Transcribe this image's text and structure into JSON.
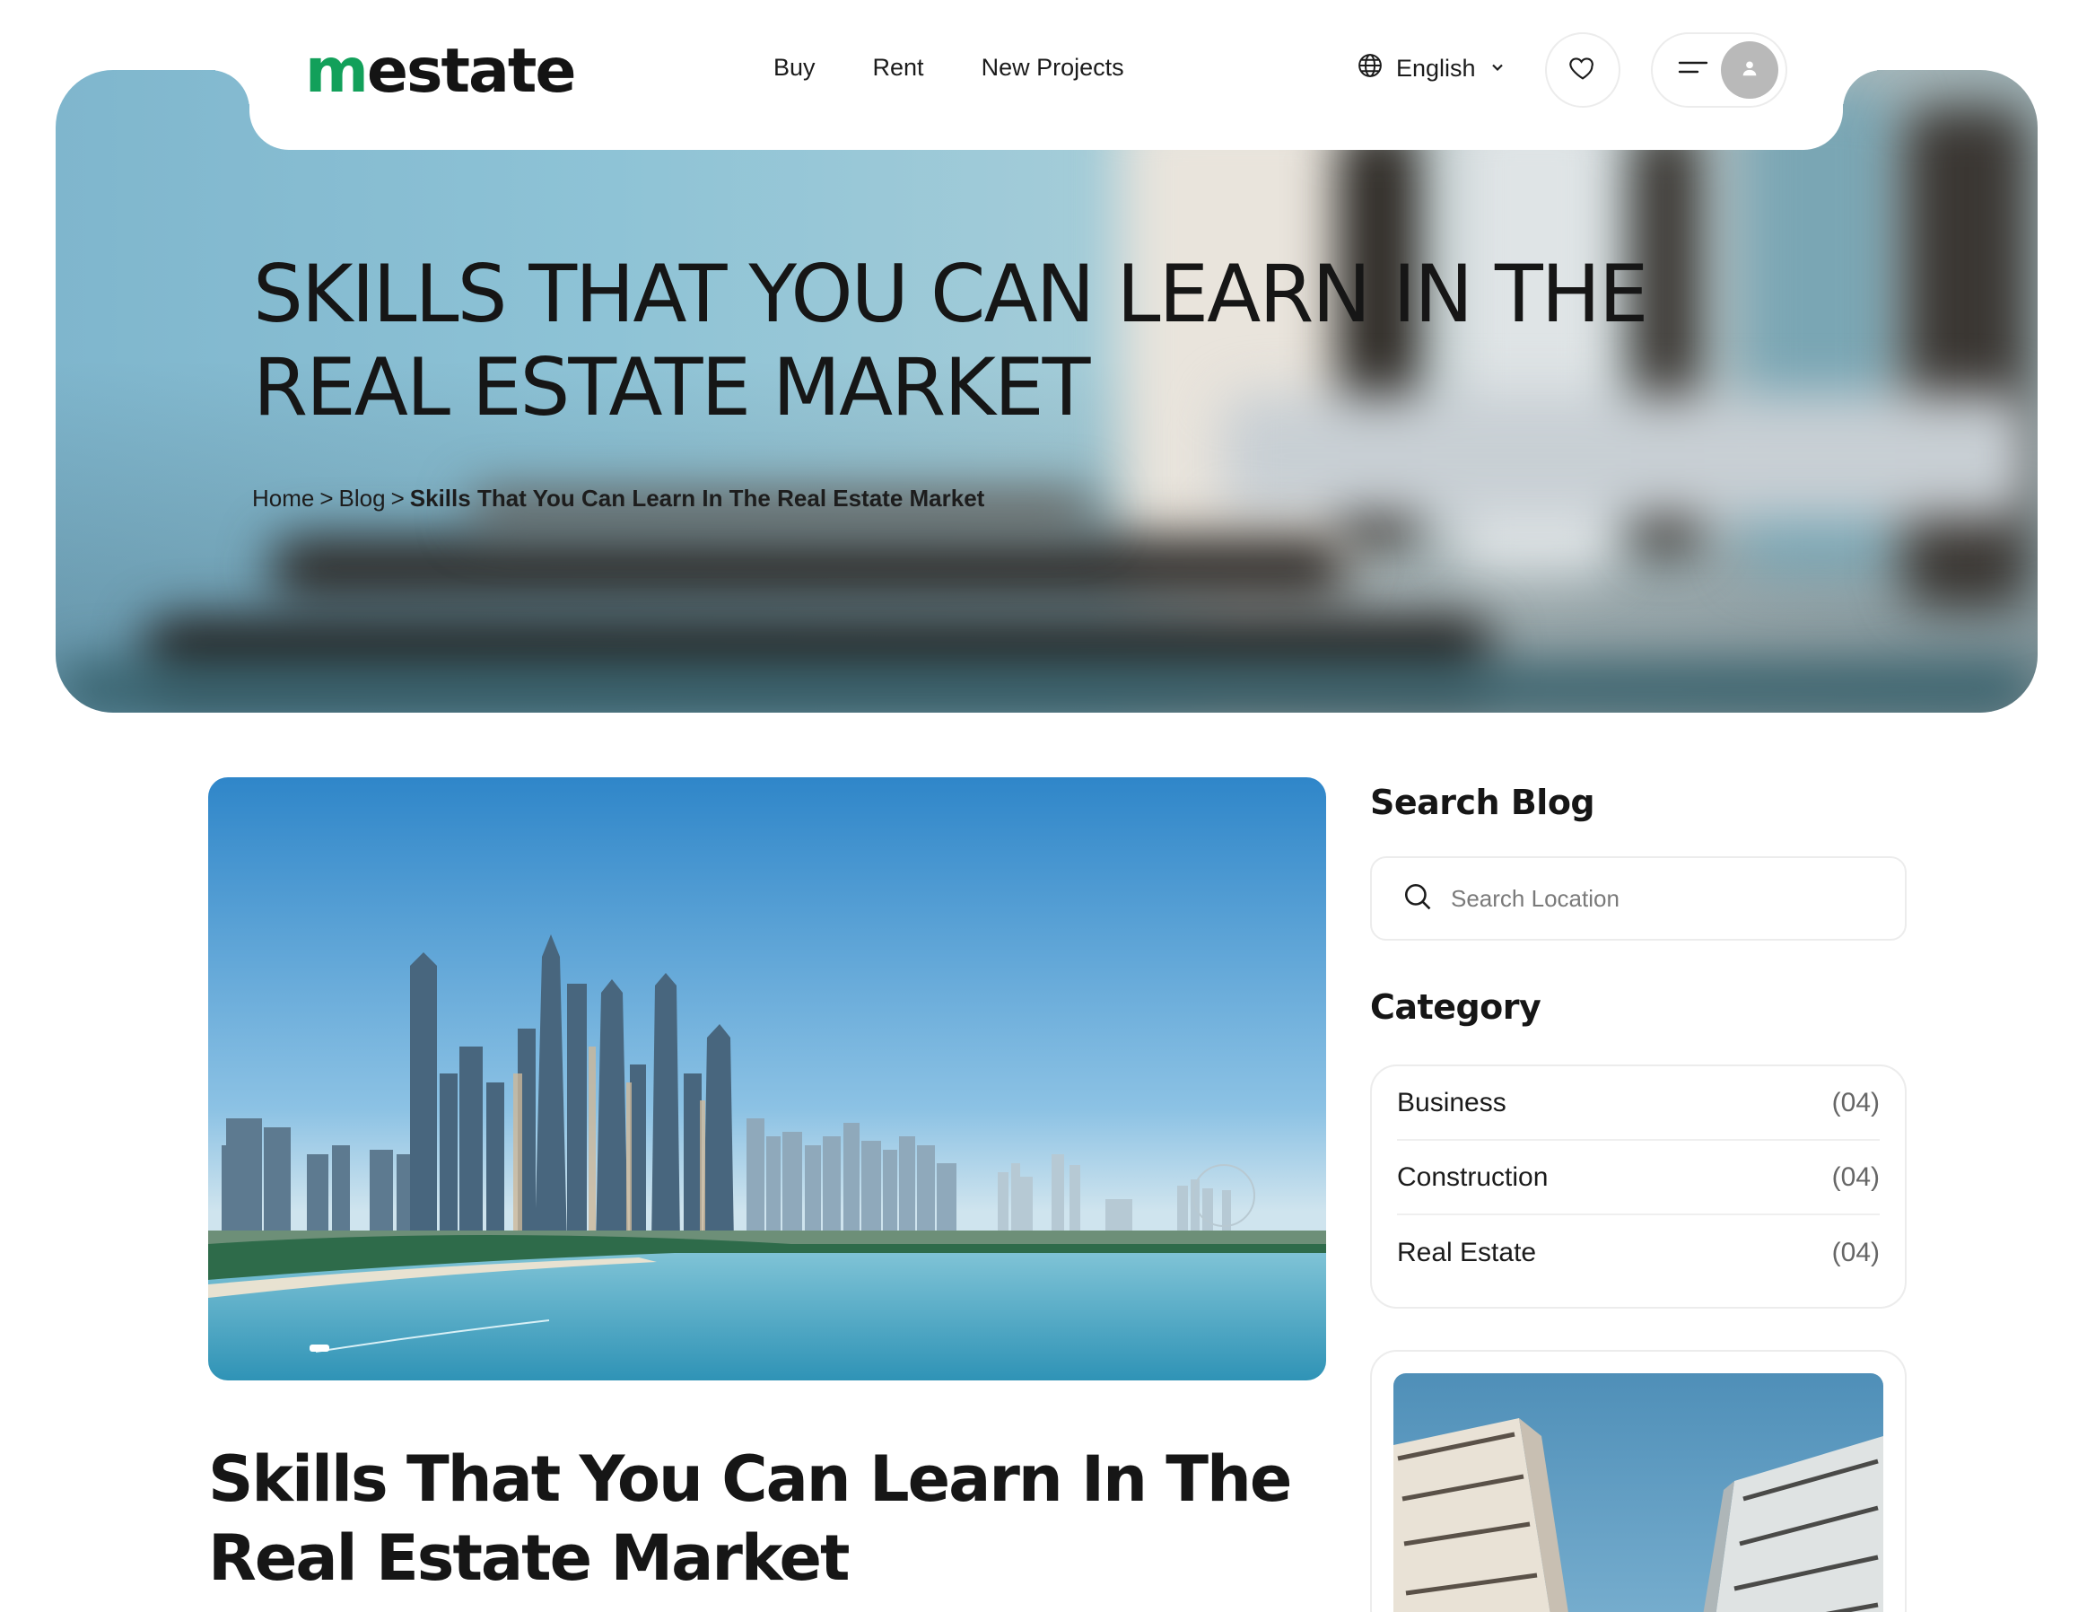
{
  "brand": {
    "logo_first": "m",
    "logo_rest": "estate",
    "accent": "#12a05a"
  },
  "nav": {
    "links": [
      "Buy",
      "Rent",
      "New Projects"
    ],
    "language": "English",
    "icons": [
      "globe-icon",
      "chevron-down-icon",
      "heart-icon",
      "hamburger-icon",
      "user-icon"
    ]
  },
  "hero": {
    "title": "SKILLS THAT YOU CAN LEARN IN THE REAL ESTATE MARKET",
    "breadcrumb": {
      "home": "Home",
      "sep": ">",
      "blog": "Blog",
      "current": "Skills That You Can Learn In The Real Estate Market"
    }
  },
  "post": {
    "title": "Skills That You Can Learn In The Real Estate Market"
  },
  "sidebar": {
    "search_heading": "Search Blog",
    "search_placeholder": "Search Location",
    "category_heading": "Category",
    "categories": [
      {
        "name": "Business",
        "count": "(04)"
      },
      {
        "name": "Construction",
        "count": "(04)"
      },
      {
        "name": "Real Estate",
        "count": "(04)"
      }
    ]
  }
}
